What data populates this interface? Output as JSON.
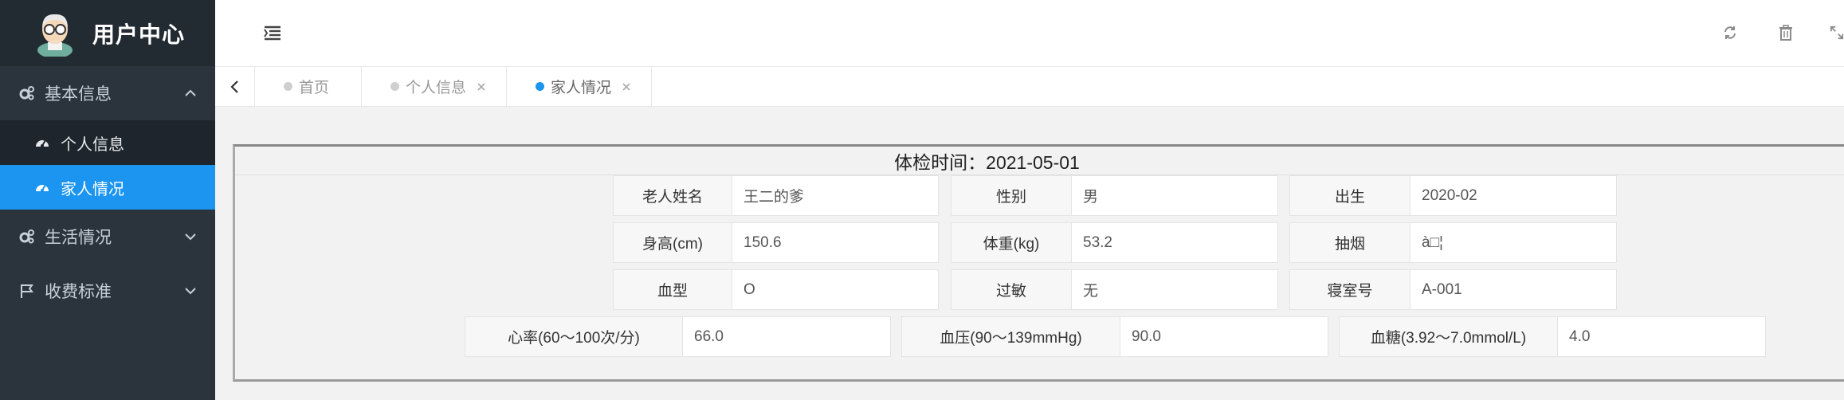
{
  "brand": {
    "title": "用户中心",
    "avatar_icon": "old-man-avatar"
  },
  "sidebar": {
    "groups": [
      {
        "label": "基本信息",
        "icon": "gears-icon",
        "expanded": true,
        "items": [
          {
            "label": "个人信息",
            "icon": "dashboard-icon",
            "active": false
          },
          {
            "label": "家人情况",
            "icon": "dashboard-icon",
            "active": true
          }
        ]
      },
      {
        "label": "生活情况",
        "icon": "gears-icon",
        "expanded": false
      },
      {
        "label": "收费标准",
        "icon": "flag-icon",
        "expanded": false
      }
    ]
  },
  "topbar": {
    "menu_toggle_icon": "indent-icon",
    "actions": [
      "refresh-icon",
      "trash-icon",
      "fullscreen-icon"
    ]
  },
  "tabs": [
    {
      "label": "首页",
      "closable": false,
      "active": false
    },
    {
      "label": "个人信息",
      "closable": true,
      "active": false
    },
    {
      "label": "家人情况",
      "closable": true,
      "active": true
    }
  ],
  "exam": {
    "title": "体检时间：2021-05-01",
    "rows": [
      [
        {
          "label": "老人姓名",
          "value": "王二的爹"
        },
        {
          "label": "性别",
          "value": "男"
        },
        {
          "label": "出生",
          "value": "2020-02"
        }
      ],
      [
        {
          "label": "身高(cm)",
          "value": "150.6"
        },
        {
          "label": "体重(kg)",
          "value": "53.2"
        },
        {
          "label": "抽烟",
          "value": "à□¦"
        }
      ],
      [
        {
          "label": "血型",
          "value": "O"
        },
        {
          "label": "过敏",
          "value": "无"
        },
        {
          "label": "寝室号",
          "value": "A-001"
        }
      ],
      [
        {
          "label": "心率(60～100次/分)",
          "value": "66.0"
        },
        {
          "label": "血压(90～139mmHg)",
          "value": "90.0"
        },
        {
          "label": "血糖(3.92～7.0mmol/L)",
          "value": "4.0"
        }
      ]
    ]
  },
  "colors": {
    "sidebar_bg": "#2b333c",
    "active_blue": "#1b95f0",
    "content_bg": "#f2f2f2"
  }
}
